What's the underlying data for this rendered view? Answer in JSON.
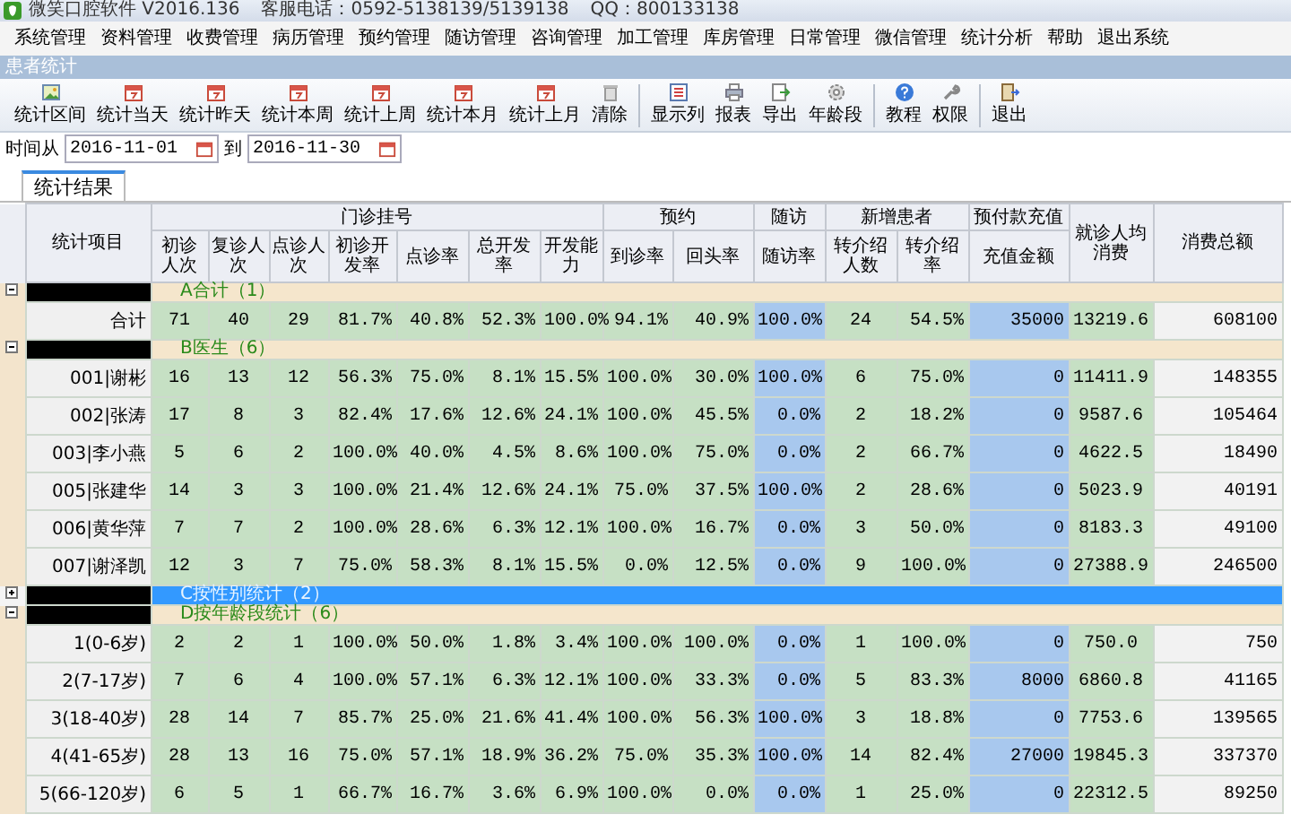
{
  "window": {
    "title": "微笑口腔软件 V2016.136",
    "hotline": "客服电话：0592-5138139/5139138",
    "qq": "QQ：800133138"
  },
  "menu": [
    "系统管理",
    "资料管理",
    "收费管理",
    "病历管理",
    "预约管理",
    "随访管理",
    "咨询管理",
    "加工管理",
    "库房管理",
    "日常管理",
    "微信管理",
    "统计分析",
    "帮助",
    "退出系统"
  ],
  "panel_title": "患者统计",
  "toolbar": [
    [
      {
        "label": "统计区间",
        "kind": "picture"
      },
      {
        "label": "统计当天",
        "kind": "calendar"
      },
      {
        "label": "统计昨天",
        "kind": "calendar"
      },
      {
        "label": "统计本周",
        "kind": "calendar"
      },
      {
        "label": "统计上周",
        "kind": "calendar"
      },
      {
        "label": "统计本月",
        "kind": "calendar"
      },
      {
        "label": "统计上月",
        "kind": "calendar"
      },
      {
        "label": "清除",
        "kind": "trash"
      }
    ],
    [
      {
        "label": "显示列",
        "kind": "list"
      },
      {
        "label": "报表",
        "kind": "printer"
      },
      {
        "label": "导出",
        "kind": "export"
      },
      {
        "label": "年龄段",
        "kind": "gear"
      }
    ],
    [
      {
        "label": "教程",
        "kind": "help"
      },
      {
        "label": "权限",
        "kind": "wrench"
      }
    ],
    [
      {
        "label": "退出",
        "kind": "exit"
      }
    ]
  ],
  "date_range": {
    "label": "时间从",
    "from": "2016-11-01",
    "separator": "到",
    "to": "2016-11-30"
  },
  "tabs": [
    {
      "label": "统计结果",
      "selected": true
    }
  ],
  "table": {
    "item_header": "统计项目",
    "column_groups": [
      {
        "label": "门诊挂号",
        "columns": [
          {
            "label": "初诊人次",
            "kind": "count"
          },
          {
            "label": "复诊人次",
            "kind": "count"
          },
          {
            "label": "点诊人次",
            "kind": "count"
          },
          {
            "label": "初诊开发率",
            "kind": "rate"
          },
          {
            "label": "点诊率",
            "kind": "rate"
          },
          {
            "label": "总开发率",
            "kind": "rate"
          },
          {
            "label": "开发能力",
            "kind": "rate"
          }
        ]
      },
      {
        "label": "预约",
        "columns": [
          {
            "label": "到诊率",
            "kind": "rate"
          },
          {
            "label": "回头率",
            "kind": "rate"
          }
        ]
      },
      {
        "label": "随访",
        "columns": [
          {
            "label": "随访率",
            "kind": "highlight"
          }
        ]
      },
      {
        "label": "新增患者",
        "columns": [
          {
            "label": "转介绍人数",
            "kind": "count"
          },
          {
            "label": "转介绍率",
            "kind": "rate"
          }
        ]
      },
      {
        "label": "预付款充值",
        "columns": [
          {
            "label": "充值金额",
            "kind": "highlight"
          }
        ]
      },
      {
        "label": "就诊人均消费",
        "kind": "count"
      },
      {
        "label": "消费总额",
        "kind": "total"
      }
    ],
    "groups": [
      {
        "label": "A合计（1）",
        "expanded": true,
        "selected": false,
        "rows": [
          {
            "item": "合计",
            "cells": [
              "71",
              "40",
              "29",
              "81.7%",
              "40.8%",
              "52.3%",
              "100.0%",
              "94.1%",
              "40.9%",
              "100.0%",
              "24",
              "54.5%",
              "35000",
              "13219.6",
              "608100"
            ]
          }
        ]
      },
      {
        "label": "B医生（6）",
        "expanded": true,
        "selected": false,
        "rows": [
          {
            "item": "001|谢彬",
            "cells": [
              "16",
              "13",
              "12",
              "56.3%",
              "75.0%",
              "8.1%",
              "15.5%",
              "100.0%",
              "30.0%",
              "100.0%",
              "6",
              "75.0%",
              "0",
              "11411.9",
              "148355"
            ]
          },
          {
            "item": "002|张涛",
            "cells": [
              "17",
              "8",
              "3",
              "82.4%",
              "17.6%",
              "12.6%",
              "24.1%",
              "100.0%",
              "45.5%",
              "0.0%",
              "2",
              "18.2%",
              "0",
              "9587.6",
              "105464"
            ]
          },
          {
            "item": "003|李小燕",
            "cells": [
              "5",
              "6",
              "2",
              "100.0%",
              "40.0%",
              "4.5%",
              "8.6%",
              "100.0%",
              "75.0%",
              "0.0%",
              "2",
              "66.7%",
              "0",
              "4622.5",
              "18490"
            ]
          },
          {
            "item": "005|张建华",
            "cells": [
              "14",
              "3",
              "3",
              "100.0%",
              "21.4%",
              "12.6%",
              "24.1%",
              "75.0%",
              "37.5%",
              "100.0%",
              "2",
              "28.6%",
              "0",
              "5023.9",
              "40191"
            ]
          },
          {
            "item": "006|黄华萍",
            "cells": [
              "7",
              "7",
              "2",
              "100.0%",
              "28.6%",
              "6.3%",
              "12.1%",
              "100.0%",
              "16.7%",
              "0.0%",
              "3",
              "50.0%",
              "0",
              "8183.3",
              "49100"
            ]
          },
          {
            "item": "007|谢泽凯",
            "cells": [
              "12",
              "3",
              "7",
              "75.0%",
              "58.3%",
              "8.1%",
              "15.5%",
              "0.0%",
              "12.5%",
              "0.0%",
              "9",
              "100.0%",
              "0",
              "27388.9",
              "246500"
            ]
          }
        ]
      },
      {
        "label": "C按性别统计（2）",
        "expanded": false,
        "selected": true
      },
      {
        "label": "D按年龄段统计（6）",
        "expanded": true,
        "selected": false,
        "rows": [
          {
            "item": "1(0-6岁)",
            "cells": [
              "2",
              "2",
              "1",
              "100.0%",
              "50.0%",
              "1.8%",
              "3.4%",
              "100.0%",
              "100.0%",
              "0.0%",
              "1",
              "100.0%",
              "0",
              "750.0",
              "750"
            ]
          },
          {
            "item": "2(7-17岁)",
            "cells": [
              "7",
              "6",
              "4",
              "100.0%",
              "57.1%",
              "6.3%",
              "12.1%",
              "100.0%",
              "33.3%",
              "0.0%",
              "5",
              "83.3%",
              "8000",
              "6860.8",
              "41165"
            ]
          },
          {
            "item": "3(18-40岁)",
            "cells": [
              "28",
              "14",
              "7",
              "85.7%",
              "25.0%",
              "21.6%",
              "41.4%",
              "100.0%",
              "56.3%",
              "100.0%",
              "3",
              "18.8%",
              "0",
              "7753.6",
              "139565"
            ]
          },
          {
            "item": "4(41-65岁)",
            "cells": [
              "28",
              "13",
              "16",
              "75.0%",
              "57.1%",
              "18.9%",
              "36.2%",
              "75.0%",
              "35.3%",
              "100.0%",
              "14",
              "82.4%",
              "27000",
              "19845.3",
              "337370"
            ]
          },
          {
            "item": "5(66-120岁)",
            "cells": [
              "6",
              "5",
              "1",
              "66.7%",
              "16.7%",
              "3.6%",
              "6.9%",
              "100.0%",
              "0.0%",
              "0.0%",
              "1",
              "25.0%",
              "0",
              "22312.5",
              "89250"
            ]
          }
        ]
      }
    ]
  }
}
